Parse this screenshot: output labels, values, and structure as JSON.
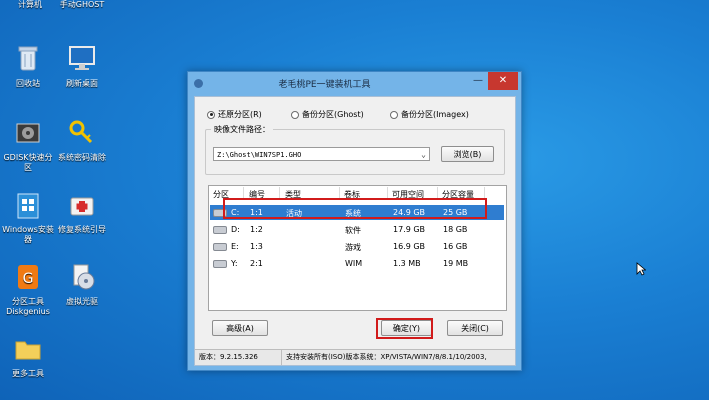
{
  "desktop": {
    "icons": [
      {
        "label": "计算机"
      },
      {
        "label": "手动GHOST"
      },
      {
        "label": "回收站"
      },
      {
        "label": "刷新桌面"
      },
      {
        "label": "GDISK快速分区"
      },
      {
        "label": "系统密码清除"
      },
      {
        "label": "Windows安装器"
      },
      {
        "label": "修复系统引导"
      },
      {
        "label": "分区工具Diskgenius"
      },
      {
        "label": "虚拟光驱"
      },
      {
        "label": "更多工具"
      }
    ]
  },
  "window": {
    "title": "老毛桃PE一键装机工具",
    "minimize": "—",
    "close": "✕",
    "modes": [
      {
        "label": "还原分区(R)",
        "checked": true
      },
      {
        "label": "备份分区(Ghost)",
        "checked": false
      },
      {
        "label": "备份分区(Imagex)",
        "checked": false
      }
    ],
    "image_group_title": "映像文件路径：",
    "image_path": "Z:\\Ghost\\WIN7SP1.GHO",
    "browse_label": "浏览(B)",
    "table": {
      "headers": [
        "分区",
        "编号",
        "类型",
        "卷标",
        "可用空间",
        "分区容量"
      ],
      "rows": [
        {
          "drive": "C:",
          "num": "1:1",
          "type": "活动",
          "label": "系统",
          "free": "24.9 GB",
          "size": "25 GB",
          "selected": true
        },
        {
          "drive": "D:",
          "num": "1:2",
          "type": "",
          "label": "软件",
          "free": "17.9 GB",
          "size": "18 GB",
          "selected": false
        },
        {
          "drive": "E:",
          "num": "1:3",
          "type": "",
          "label": "游戏",
          "free": "16.9 GB",
          "size": "16 GB",
          "selected": false
        },
        {
          "drive": "Y:",
          "num": "2:1",
          "type": "",
          "label": "WIM",
          "free": "1.3 MB",
          "size": "19 MB",
          "selected": false
        }
      ]
    },
    "advanced_label": "高级(A)",
    "ok_label": "确定(Y)",
    "close_label": "关闭(C)",
    "status_version": "版本：9.2.15.326",
    "status_support": "支持安装所有(ISO)版本系统：XP/VISTA/WIN7/8/8.1/10/2003,"
  },
  "colors": {
    "accent": "#2f7dd0",
    "highlight_box": "#d11b1b"
  }
}
